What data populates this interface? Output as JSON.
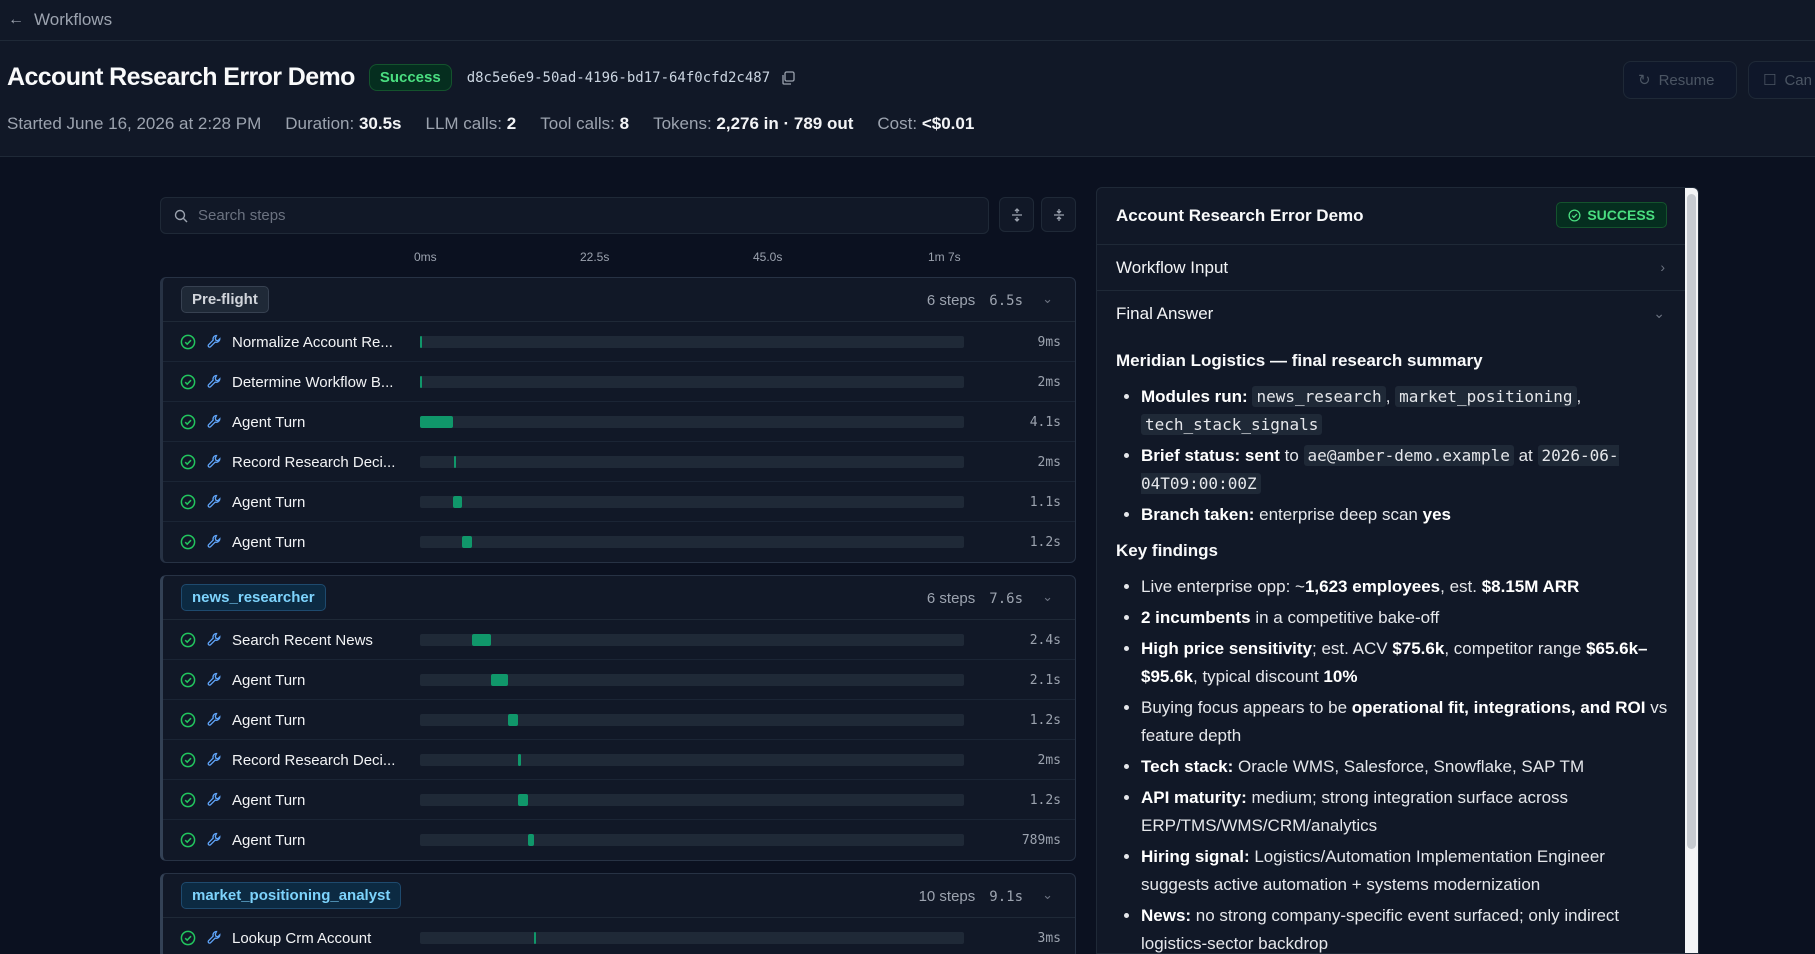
{
  "nav": {
    "back_label": "Workflows"
  },
  "run": {
    "title": "Account Research Error Demo",
    "status": "Success",
    "id": "d8c5e6e9-50ad-4196-bd17-64f0cfd2c487",
    "started": "Started June 16, 2026 at 2:28 PM",
    "duration_label": "Duration:",
    "duration": "30.5s",
    "llm_label": "LLM calls:",
    "llm_calls": "2",
    "tool_label": "Tool calls:",
    "tool_calls": "8",
    "tokens_label": "Tokens:",
    "tokens": "2,276 in · 789 out",
    "cost_label": "Cost:",
    "cost": "<$0.01"
  },
  "actions": {
    "resume": "Resume",
    "cancel": "Can"
  },
  "search": {
    "placeholder": "Search steps"
  },
  "axis": {
    "ticks": [
      "0ms",
      "22.5s",
      "45.0s",
      "1m 7s"
    ]
  },
  "groups": [
    {
      "name": "Pre-flight",
      "steps_count": "6 steps",
      "duration": "6.5s",
      "steps": [
        {
          "name": "Normalize Account Re...",
          "duration": "9ms",
          "start": 0.0,
          "width": 0.003
        },
        {
          "name": "Determine Workflow B...",
          "duration": "2ms",
          "start": 0.0,
          "width": 0.003
        },
        {
          "name": "Agent Turn",
          "duration": "4.1s",
          "start": 0.0,
          "width": 0.061
        },
        {
          "name": "Record Research Deci...",
          "duration": "2ms",
          "start": 0.062,
          "width": 0.004
        },
        {
          "name": "Agent Turn",
          "duration": "1.1s",
          "start": 0.061,
          "width": 0.017
        },
        {
          "name": "Agent Turn",
          "duration": "1.2s",
          "start": 0.078,
          "width": 0.018
        }
      ]
    },
    {
      "name": "news_researcher",
      "steps_count": "6 steps",
      "duration": "7.6s",
      "steps": [
        {
          "name": "Search Recent News",
          "duration": "2.4s",
          "start": 0.096,
          "width": 0.035
        },
        {
          "name": "Agent Turn",
          "duration": "2.1s",
          "start": 0.131,
          "width": 0.031
        },
        {
          "name": "Agent Turn",
          "duration": "1.2s",
          "start": 0.162,
          "width": 0.018
        },
        {
          "name": "Record Research Deci...",
          "duration": "2ms",
          "start": 0.181,
          "width": 0.004
        },
        {
          "name": "Agent Turn",
          "duration": "1.2s",
          "start": 0.18,
          "width": 0.018
        },
        {
          "name": "Agent Turn",
          "duration": "789ms",
          "start": 0.198,
          "width": 0.012
        }
      ]
    },
    {
      "name": "market_positioning_analyst",
      "steps_count": "10 steps",
      "duration": "9.1s",
      "steps": [
        {
          "name": "Lookup Crm Account",
          "duration": "3ms",
          "start": 0.21,
          "width": 0.004
        }
      ]
    }
  ],
  "panel": {
    "title": "Account Research Error Demo",
    "status": "SUCCESS",
    "workflow_input": "Workflow Input",
    "final_answer": "Final Answer",
    "summary_title": "Meridian Logistics — final research summary",
    "modules_label": "Modules run:",
    "modules": [
      "news_research",
      "market_positioning",
      "tech_stack_signals"
    ],
    "brief_label": "Brief status:",
    "brief_sent": "sent",
    "brief_to": "to",
    "brief_email": "ae@amber-demo.example",
    "brief_at": "at",
    "brief_time": "2026-06-04T09:00:00Z",
    "branch_label": "Branch taken:",
    "branch_value": "enterprise deep scan",
    "branch_yes": "yes",
    "key_findings": "Key findings",
    "f1_pre": "Live enterprise opp: ~",
    "f1_b1": "1,623 employees",
    "f1_mid": ", est. ",
    "f1_b2": "$8.15M ARR",
    "f2_b": "2 incumbents",
    "f2_rest": " in a competitive bake-off",
    "f3_b1": "High price sensitivity",
    "f3_mid": "; est. ACV ",
    "f3_b2": "$75.6k",
    "f3_mid2": ", competitor range ",
    "f3_b3": "$65.6k–$95.6k",
    "f3_mid3": ", typical discount ",
    "f3_b4": "10%",
    "f4_pre": "Buying focus appears to be ",
    "f4_b": "operational fit, integrations, and ROI",
    "f4_rest": " vs feature depth",
    "f5_b": "Tech stack:",
    "f5_rest": " Oracle WMS, Salesforce, Snowflake, SAP TM",
    "f6_b": "API maturity:",
    "f6_rest": " medium; strong integration surface across ERP/TMS/WMS/CRM/analytics",
    "f7_b": "Hiring signal:",
    "f7_rest": " Logistics/Automation Implementation Engineer suggests active automation + systems modernization",
    "f8_b": "News:",
    "f8_rest": " no strong company-specific event surfaced; only indirect logistics-sector backdrop"
  },
  "colors": {
    "accent": "#10976a",
    "success": "#4ade80",
    "background": "#0b1120"
  }
}
